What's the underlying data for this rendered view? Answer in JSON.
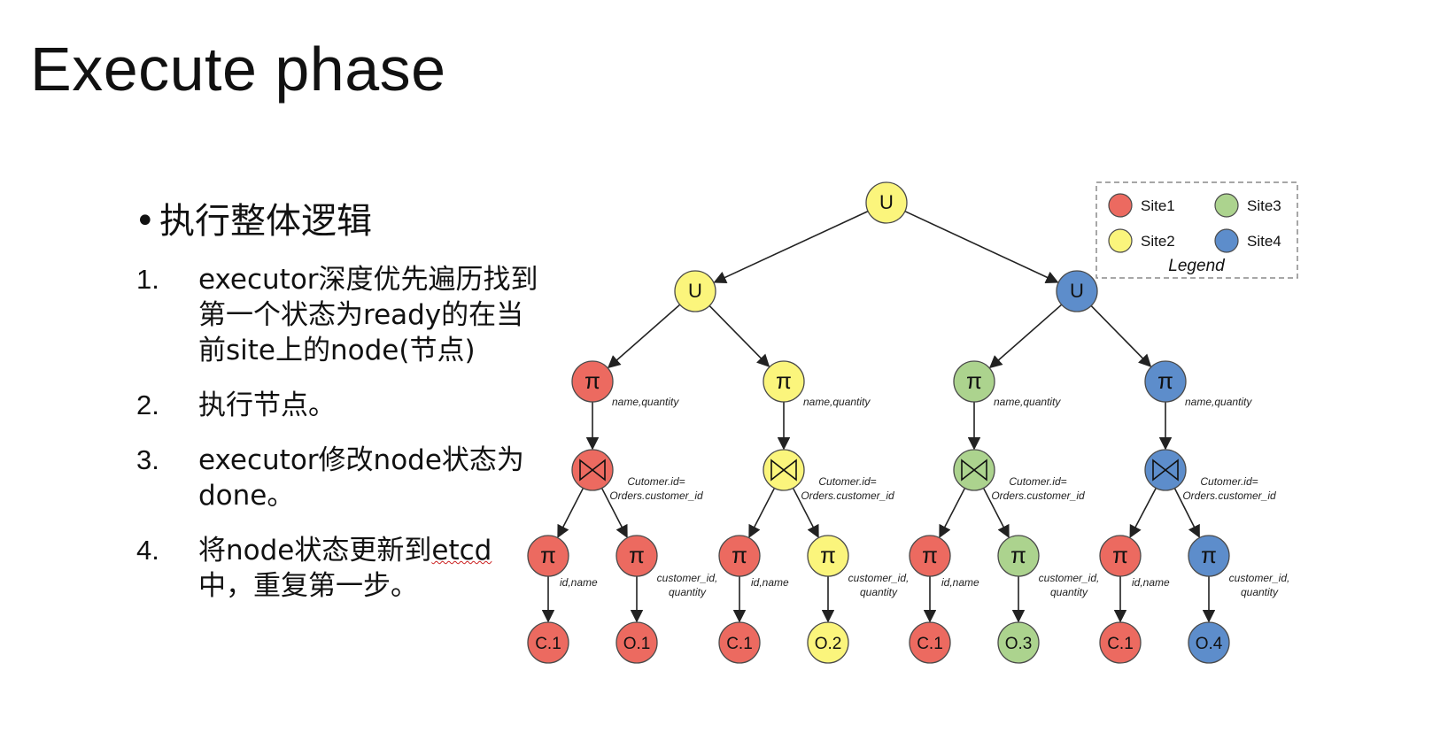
{
  "slide": {
    "title": "Execute phase",
    "bullet": "执行整体逻辑",
    "steps": [
      {
        "num": "1.",
        "text": "executor深度优先遍历找到第一个状态为ready的在当前site上的node(节点)"
      },
      {
        "num": "2.",
        "text": "执行节点。"
      },
      {
        "num": "3.",
        "text": "executor修改node状态为done。"
      },
      {
        "num": "4.",
        "text_before": "将node状态更新到",
        "text_marked": "etcd",
        "text_after": "中，重复第一步。"
      }
    ]
  },
  "colors": {
    "site1": "#ec6a60",
    "site2": "#fbf57c",
    "site3": "#acd38e",
    "site4": "#5d8dcb",
    "edge": "#222222"
  },
  "legend": {
    "title": "Legend",
    "items": [
      {
        "label": "Site1",
        "site": "site1"
      },
      {
        "label": "Site3",
        "site": "site3"
      },
      {
        "label": "Site2",
        "site": "site2"
      },
      {
        "label": "Site4",
        "site": "site4"
      }
    ]
  },
  "tree": {
    "nodes": [
      {
        "id": "root",
        "kind": "union",
        "label": "U",
        "site": "site2"
      },
      {
        "id": "u_left",
        "kind": "union",
        "label": "U",
        "site": "site2"
      },
      {
        "id": "u_right",
        "kind": "union",
        "label": "U",
        "site": "site4"
      },
      {
        "id": "p1",
        "kind": "project",
        "label": "π",
        "site": "site1",
        "annotation": "name,quantity"
      },
      {
        "id": "p2",
        "kind": "project",
        "label": "π",
        "site": "site2",
        "annotation": "name,quantity"
      },
      {
        "id": "p3",
        "kind": "project",
        "label": "π",
        "site": "site3",
        "annotation": "name,quantity"
      },
      {
        "id": "p4",
        "kind": "project",
        "label": "π",
        "site": "site4",
        "annotation": "name,quantity"
      },
      {
        "id": "j1",
        "kind": "join",
        "label": "",
        "site": "site1",
        "annotation": [
          "Cutomer.id=",
          "Orders.customer_id"
        ]
      },
      {
        "id": "j2",
        "kind": "join",
        "label": "",
        "site": "site2",
        "annotation": [
          "Cutomer.id=",
          "Orders.customer_id"
        ]
      },
      {
        "id": "j3",
        "kind": "join",
        "label": "",
        "site": "site3",
        "annotation": [
          "Cutomer.id=",
          "Orders.customer_id"
        ]
      },
      {
        "id": "j4",
        "kind": "join",
        "label": "",
        "site": "site4",
        "annotation": [
          "Cutomer.id=",
          "Orders.customer_id"
        ]
      },
      {
        "id": "q1a",
        "kind": "project",
        "label": "π",
        "site": "site1",
        "annotation": "id,name"
      },
      {
        "id": "q1b",
        "kind": "project",
        "label": "π",
        "site": "site1",
        "annotation": [
          "customer_id,",
          "quantity"
        ]
      },
      {
        "id": "q2a",
        "kind": "project",
        "label": "π",
        "site": "site1",
        "annotation": "id,name"
      },
      {
        "id": "q2b",
        "kind": "project",
        "label": "π",
        "site": "site2",
        "annotation": [
          "customer_id,",
          "quantity"
        ]
      },
      {
        "id": "q3a",
        "kind": "project",
        "label": "π",
        "site": "site1",
        "annotation": "id,name"
      },
      {
        "id": "q3b",
        "kind": "project",
        "label": "π",
        "site": "site3",
        "annotation": [
          "customer_id,",
          "quantity"
        ]
      },
      {
        "id": "q4a",
        "kind": "project",
        "label": "π",
        "site": "site1",
        "annotation": "id,name"
      },
      {
        "id": "q4b",
        "kind": "project",
        "label": "π",
        "site": "site4",
        "annotation": [
          "customer_id,",
          "quantity"
        ]
      },
      {
        "id": "l1a",
        "kind": "leaf",
        "label": "C.1",
        "site": "site1"
      },
      {
        "id": "l1b",
        "kind": "leaf",
        "label": "O.1",
        "site": "site1"
      },
      {
        "id": "l2a",
        "kind": "leaf",
        "label": "C.1",
        "site": "site1"
      },
      {
        "id": "l2b",
        "kind": "leaf",
        "label": "O.2",
        "site": "site2"
      },
      {
        "id": "l3a",
        "kind": "leaf",
        "label": "C.1",
        "site": "site1"
      },
      {
        "id": "l3b",
        "kind": "leaf",
        "label": "O.3",
        "site": "site3"
      },
      {
        "id": "l4a",
        "kind": "leaf",
        "label": "C.1",
        "site": "site1"
      },
      {
        "id": "l4b",
        "kind": "leaf",
        "label": "O.4",
        "site": "site4"
      }
    ],
    "edges": [
      [
        "root",
        "u_left"
      ],
      [
        "root",
        "u_right"
      ],
      [
        "u_left",
        "p1"
      ],
      [
        "u_left",
        "p2"
      ],
      [
        "u_right",
        "p3"
      ],
      [
        "u_right",
        "p4"
      ],
      [
        "p1",
        "j1"
      ],
      [
        "p2",
        "j2"
      ],
      [
        "p3",
        "j3"
      ],
      [
        "p4",
        "j4"
      ],
      [
        "j1",
        "q1a"
      ],
      [
        "j1",
        "q1b"
      ],
      [
        "j2",
        "q2a"
      ],
      [
        "j2",
        "q2b"
      ],
      [
        "j3",
        "q3a"
      ],
      [
        "j3",
        "q3b"
      ],
      [
        "j4",
        "q4a"
      ],
      [
        "j4",
        "q4b"
      ],
      [
        "q1a",
        "l1a"
      ],
      [
        "q1b",
        "l1b"
      ],
      [
        "q2a",
        "l2a"
      ],
      [
        "q2b",
        "l2b"
      ],
      [
        "q3a",
        "l3a"
      ],
      [
        "q3b",
        "l3b"
      ],
      [
        "q4a",
        "l4a"
      ],
      [
        "q4b",
        "l4b"
      ]
    ]
  }
}
